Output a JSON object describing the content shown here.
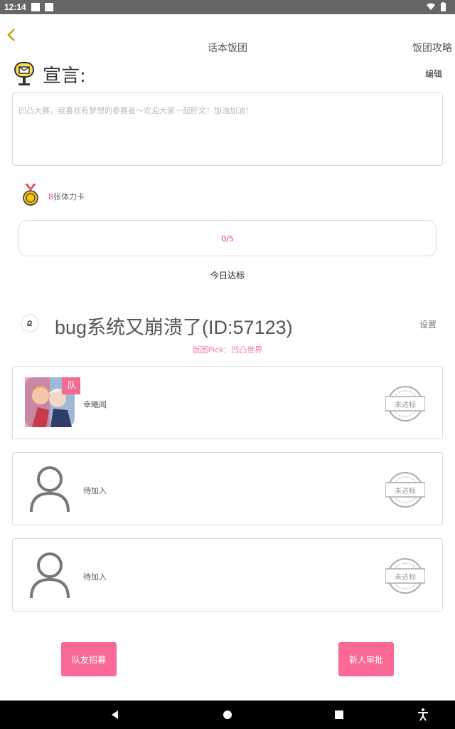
{
  "status_bar": {
    "time": "12:14"
  },
  "header": {
    "title": "话本饭团",
    "guide": "饭团攻略"
  },
  "manifesto": {
    "title": "宣言:",
    "edit": "编辑",
    "text": "凹凸大赛，我喜欢有梦想的参赛者～欢迎大家一起肝文！加油加油！"
  },
  "stamina": {
    "count": "8",
    "unit": "张体力卡"
  },
  "progress": {
    "text": "0/5",
    "value": 0,
    "max": 5
  },
  "daily": {
    "label": "今日达标"
  },
  "team": {
    "name": "bug系统又崩溃了(ID:57123)",
    "settings": "设置",
    "pick": "饭团Pick：凹凸世界"
  },
  "members": [
    {
      "name": "幸曦闻",
      "stamp": "未达标",
      "badge": "队"
    },
    {
      "name": "待加入",
      "stamp": "未达标"
    },
    {
      "name": "待加入",
      "stamp": "未达标"
    }
  ],
  "buttons": {
    "recruit": "队友招募",
    "approve": "新人审批"
  },
  "colors": {
    "accent": "#fa6994",
    "pink_text": "#d83a6e",
    "status_bar": "#666666",
    "nav_bar": "#000000"
  },
  "icons": {
    "back": "chevron-left-icon",
    "mailbox": "mailbox-icon",
    "medal": "medal-icon",
    "stamp": "stamp-icon",
    "person": "person-icon"
  }
}
